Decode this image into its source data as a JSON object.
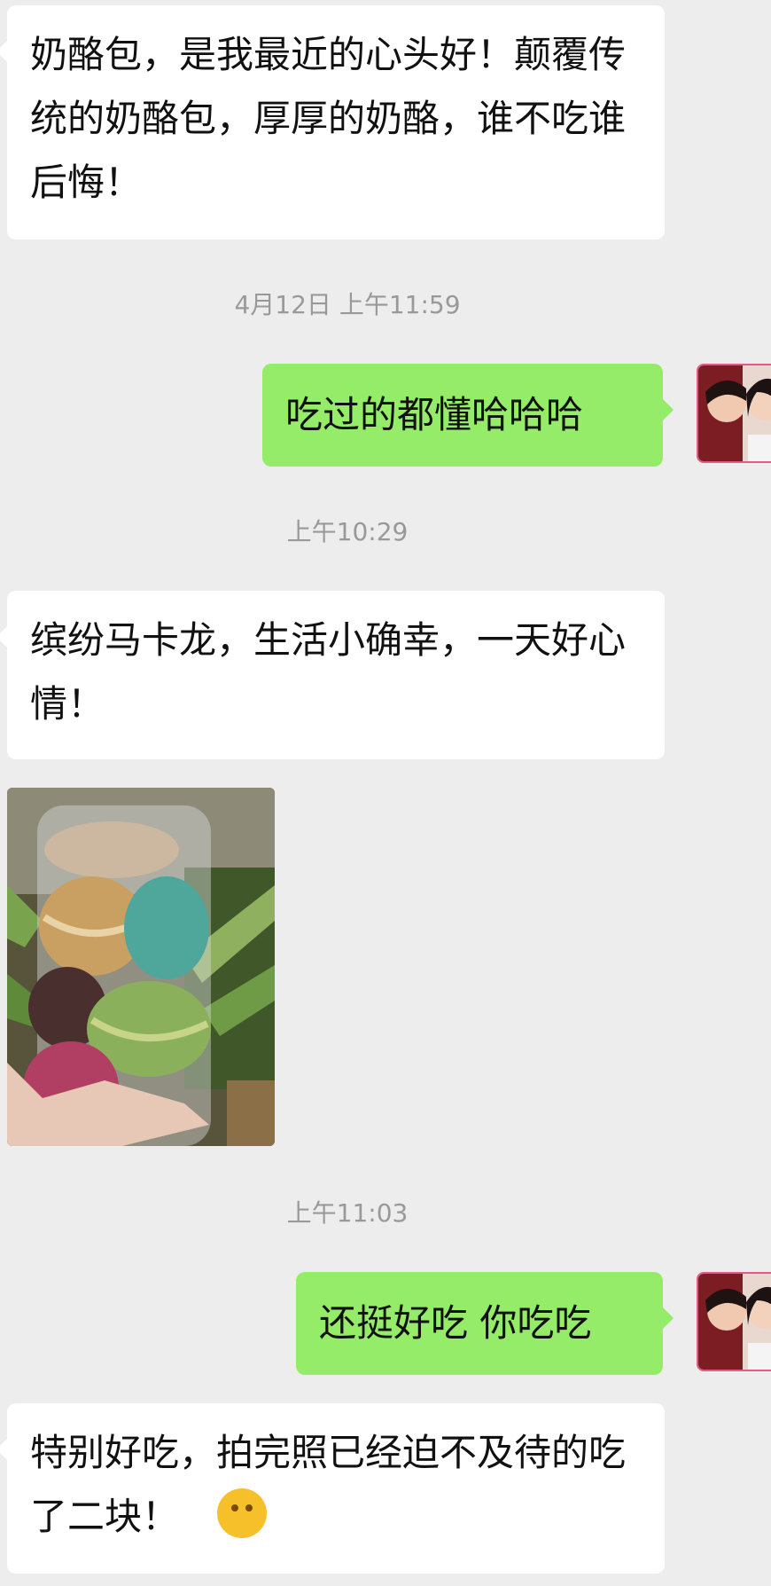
{
  "messages": [
    {
      "id": "m1",
      "text": "奶酪包，是我最近的心头好！颠覆传统的奶酪包，厚厚的奶酪，谁不吃谁后悔！"
    },
    {
      "id": "m2",
      "text": "吃过的都懂哈哈哈"
    },
    {
      "id": "m3",
      "text": "缤纷马卡龙，生活小确幸，一天好心情！"
    },
    {
      "id": "m4",
      "text": "还挺好吃 你吃吃"
    },
    {
      "id": "m5",
      "text": "特别好吃，拍完照已经迫不及待的吃了二块！"
    }
  ],
  "timestamps": [
    {
      "id": "t1",
      "text": "4月12日 上午11:59"
    },
    {
      "id": "t2",
      "text": "上午10:29"
    },
    {
      "id": "t3",
      "text": "上午11:03"
    }
  ],
  "icons": {
    "avatar": "user-avatar",
    "emoji": "thinking-face-emoji"
  },
  "colors": {
    "background": "#ededed",
    "incoming_bubble": "#ffffff",
    "outgoing_bubble": "#95ec69",
    "timestamp_text": "#999999"
  }
}
